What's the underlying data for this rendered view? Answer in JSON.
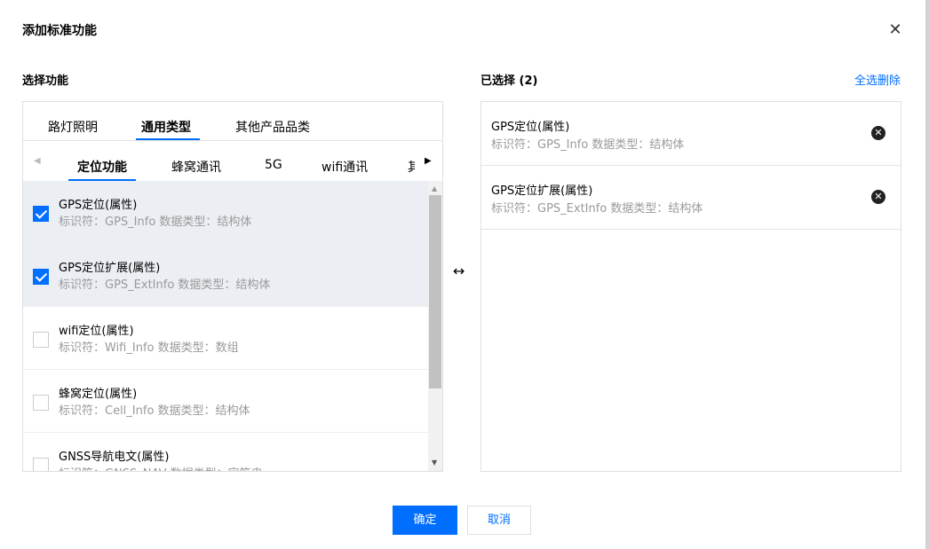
{
  "dialog": {
    "title": "添加标准功能",
    "close_icon": "close-icon"
  },
  "left": {
    "label": "选择功能",
    "tabs": [
      "路灯照明",
      "通用类型",
      "其他产品品类"
    ],
    "active_tab": "通用类型",
    "subtabs": [
      "定位功能",
      "蜂窝通讯",
      "5G",
      "wifi通讯",
      "其"
    ],
    "active_subtab": "定位功能",
    "items": [
      {
        "name": "GPS定位(属性)",
        "meta": "标识符：GPS_Info  数据类型：结构体",
        "checked": true
      },
      {
        "name": "GPS定位扩展(属性)",
        "meta": "标识符：GPS_ExtInfo  数据类型：结构体",
        "checked": true
      },
      {
        "name": "wifi定位(属性)",
        "meta": "标识符：Wifi_Info  数据类型：数组",
        "checked": false
      },
      {
        "name": "蜂窝定位(属性)",
        "meta": "标识符：Cell_Info  数据类型：结构体",
        "checked": false
      },
      {
        "name": "GNSS导航电文(属性)",
        "meta": "标识符：GNSS_NAV  数据类型：字符串",
        "checked": false
      }
    ]
  },
  "right": {
    "label": "已选择 (2)",
    "select_all_delete": "全选删除",
    "items": [
      {
        "name": "GPS定位(属性)",
        "meta": "标识符：GPS_Info  数据类型：结构体"
      },
      {
        "name": "GPS定位扩展(属性)",
        "meta": "标识符：GPS_ExtInfo  数据类型：结构体"
      }
    ]
  },
  "footer": {
    "confirm": "确定",
    "cancel": "取消"
  },
  "colors": {
    "accent": "#006eff",
    "selected_row": "#ebeff4",
    "muted_text": "#999999"
  }
}
